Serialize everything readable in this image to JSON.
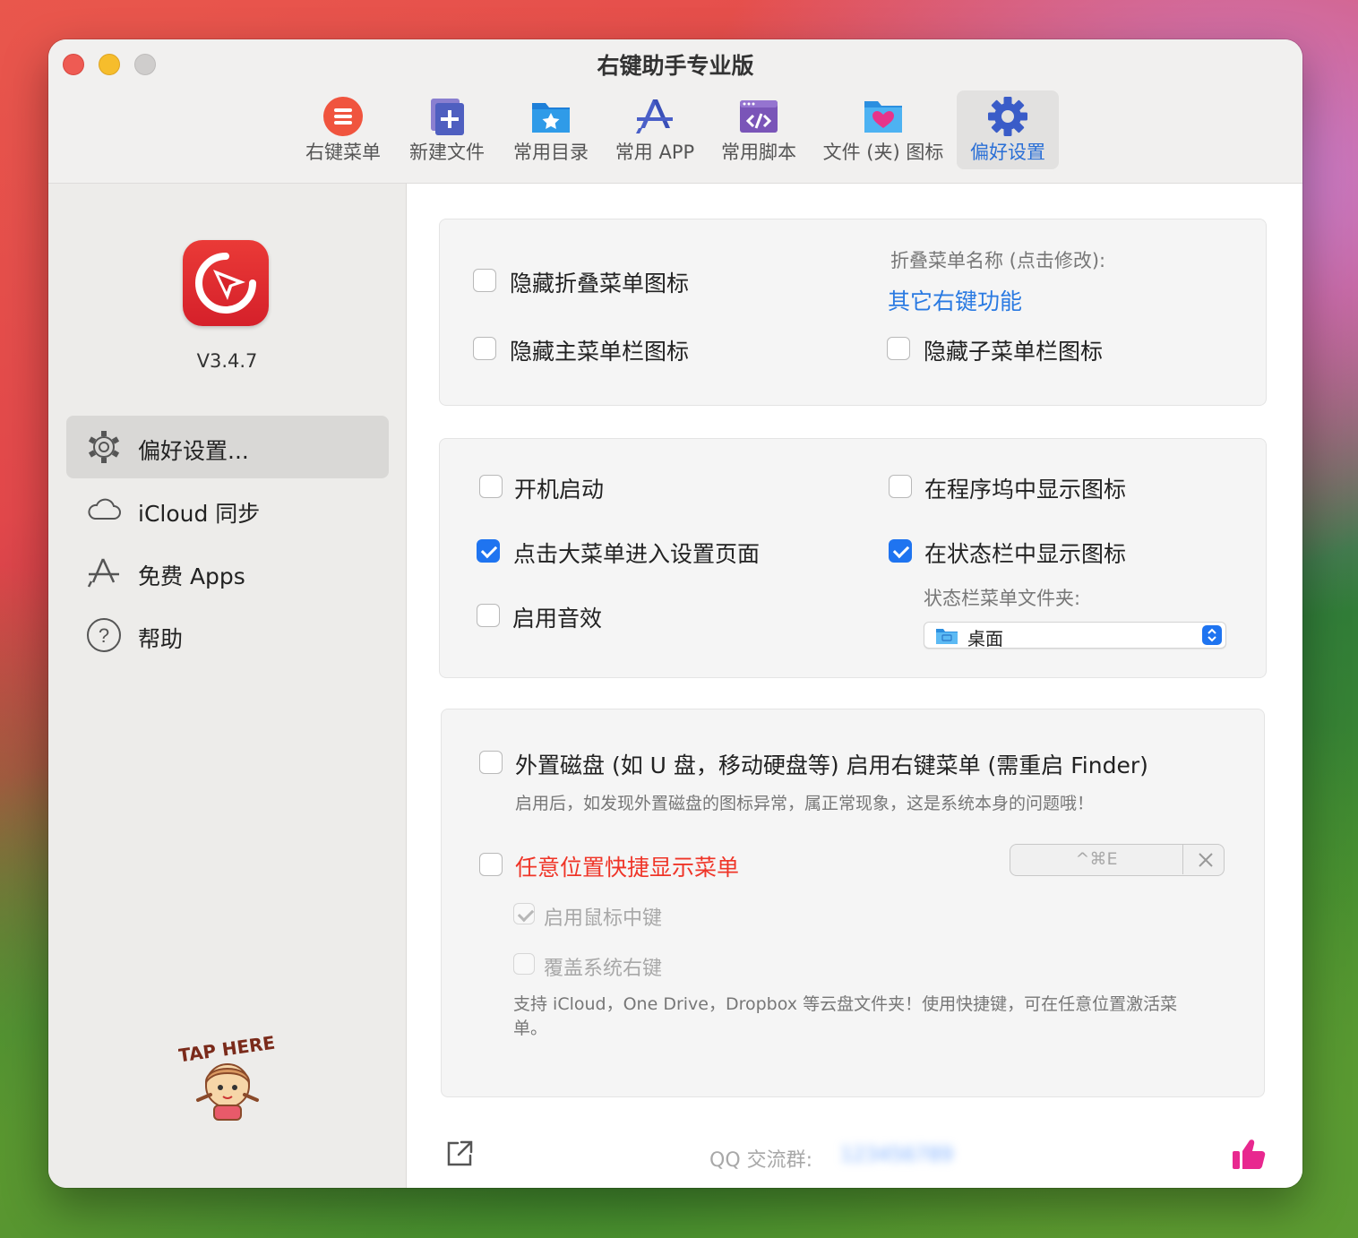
{
  "window": {
    "title": "右键助手专业版"
  },
  "toolbar": {
    "tabs": [
      {
        "label": "右键菜单",
        "icon": "list-circle-icon"
      },
      {
        "label": "新建文件",
        "icon": "new-file-icon"
      },
      {
        "label": "常用目录",
        "icon": "folder-star-icon"
      },
      {
        "label": "常用 APP",
        "icon": "app-store-icon"
      },
      {
        "label": "常用脚本",
        "icon": "script-icon"
      },
      {
        "label": "文件 (夹) 图标",
        "icon": "folder-heart-icon"
      },
      {
        "label": "偏好设置",
        "icon": "gear-icon",
        "active": true
      }
    ]
  },
  "sidebar": {
    "version": "V3.4.7",
    "items": [
      {
        "label": "偏好设置...",
        "icon": "gear-icon",
        "active": true
      },
      {
        "label": "iCloud 同步",
        "icon": "cloud-icon"
      },
      {
        "label": "免费 Apps",
        "icon": "app-store-icon"
      },
      {
        "label": "帮助",
        "icon": "help-icon"
      }
    ],
    "mascot_text": "TAP HERE"
  },
  "panel1": {
    "hide_fold_icon": {
      "label": "隐藏折叠菜单图标",
      "checked": false
    },
    "hide_main_icon": {
      "label": "隐藏主菜单栏图标",
      "checked": false
    },
    "fold_name_label": "折叠菜单名称 (点击修改):",
    "fold_name_value": "其它右键功能",
    "hide_sub_icon": {
      "label": "隐藏子菜单栏图标",
      "checked": false
    }
  },
  "panel2": {
    "launch_at_login": {
      "label": "开机启动",
      "checked": false
    },
    "click_menu_settings": {
      "label": "点击大菜单进入设置页面",
      "checked": true
    },
    "sound": {
      "label": "启用音效",
      "checked": false
    },
    "dock_icon": {
      "label": "在程序坞中显示图标",
      "checked": false
    },
    "statusbar_icon": {
      "label": "在状态栏中显示图标",
      "checked": true
    },
    "statusbar_folder_label": "状态栏菜单文件夹:",
    "statusbar_folder_value": "桌面"
  },
  "panel3": {
    "external_disk": {
      "label": "外置磁盘 (如 U 盘，移动硬盘等) 启用右键菜单 (需重启 Finder)",
      "checked": false
    },
    "external_hint": "启用后，如发现外置磁盘的图标异常，属正常现象，这是系统本身的问题哦！",
    "quick_menu": {
      "label": "任意位置快捷显示菜单",
      "checked": false
    },
    "shortcut": "^⌘E",
    "middle_click": {
      "label": "启用鼠标中键",
      "checked": true,
      "disabled": true
    },
    "override_right": {
      "label": "覆盖系统右键",
      "checked": false,
      "disabled": true
    },
    "quick_hint": "支持 iCloud，One Drive，Dropbox 等云盘文件夹！使用快捷键，可在任意位置激活菜单。"
  },
  "footer": {
    "qq_label": "QQ 交流群:",
    "qq_number": "123456789"
  },
  "colors": {
    "accent": "#1f74f0",
    "link": "#2a7ae2",
    "warning": "#ef3528",
    "like": "#e8288f"
  }
}
